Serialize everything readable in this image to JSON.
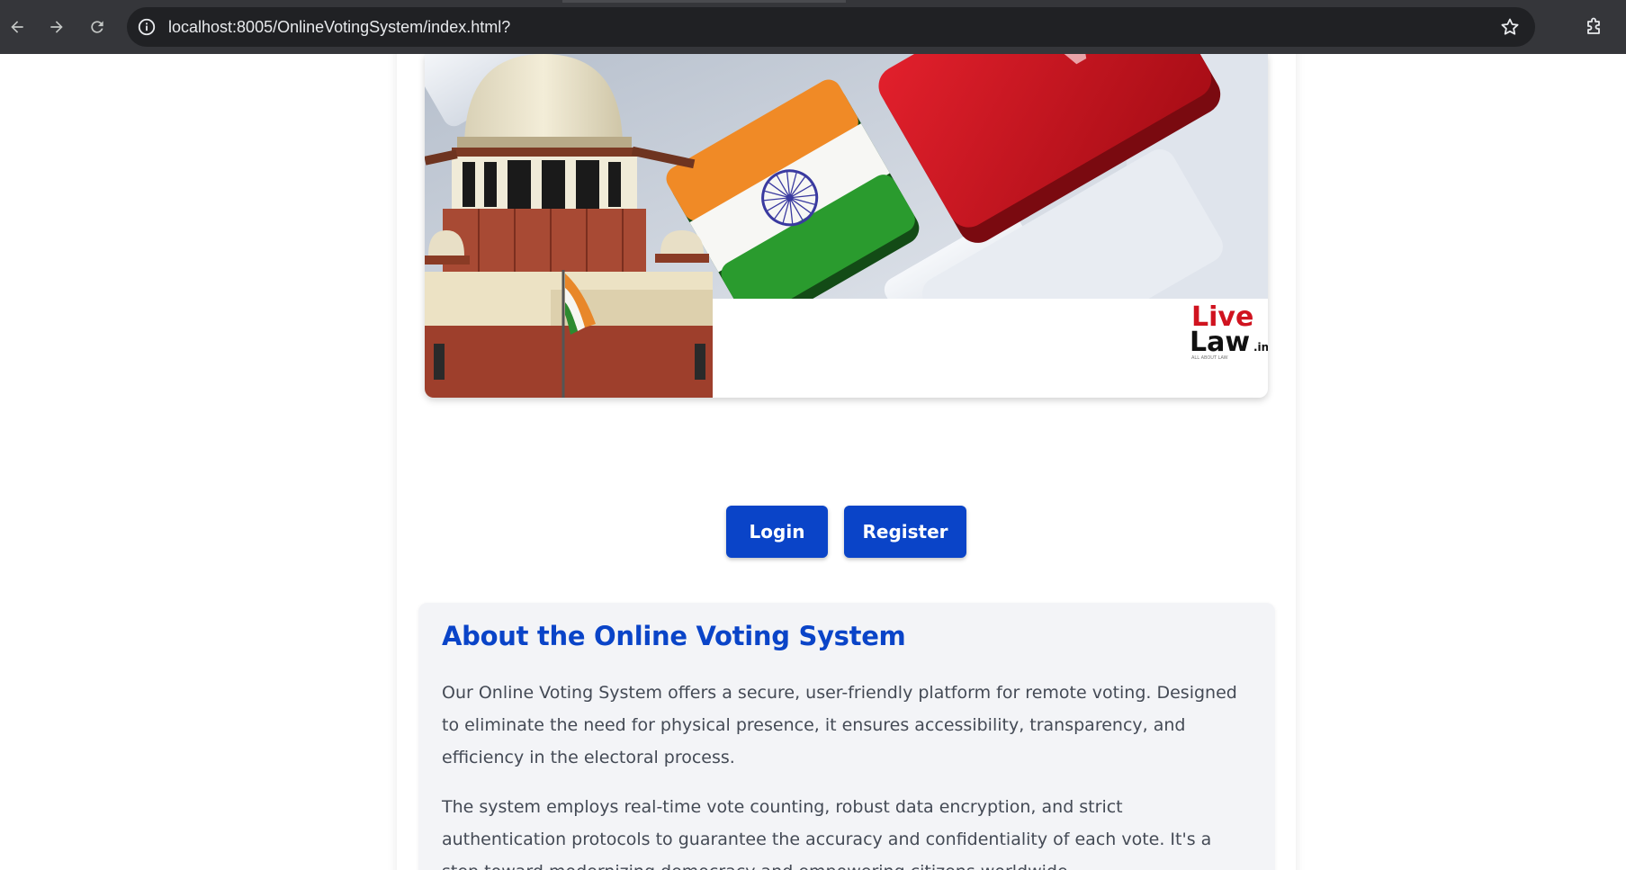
{
  "browser": {
    "url": "localhost:8005/OnlineVotingSystem/index.html?",
    "icons": {
      "back": "arrow-left-icon",
      "forward": "arrow-right-icon",
      "reload": "reload-icon",
      "site_info": "info-icon",
      "bookmark": "star-icon",
      "extensions": "puzzle-icon"
    }
  },
  "hero": {
    "logo_line1": "Live",
    "logo_line2": "Law",
    "logo_suffix": ".in",
    "logo_tagline": "ALL ABOUT LAW"
  },
  "actions": {
    "login_label": "Login",
    "register_label": "Register"
  },
  "about": {
    "title": "About the Online Voting System",
    "paragraph1": "Our Online Voting System offers a secure, user-friendly platform for remote voting. Designed to eliminate the need for physical presence, it ensures accessibility, transparency, and efficiency in the electoral process.",
    "paragraph2": "The system employs real-time vote counting, robust data encryption, and strict authentication protocols to guarantee the accuracy and confidentiality of each vote. It's a step toward modernizing democracy and empowering citizens worldwide."
  },
  "colors": {
    "accent": "#0a44c8",
    "chrome_bg": "#35363a",
    "omnibox_bg": "#202124",
    "about_bg": "#f3f4f7",
    "body_text": "#444a55"
  }
}
